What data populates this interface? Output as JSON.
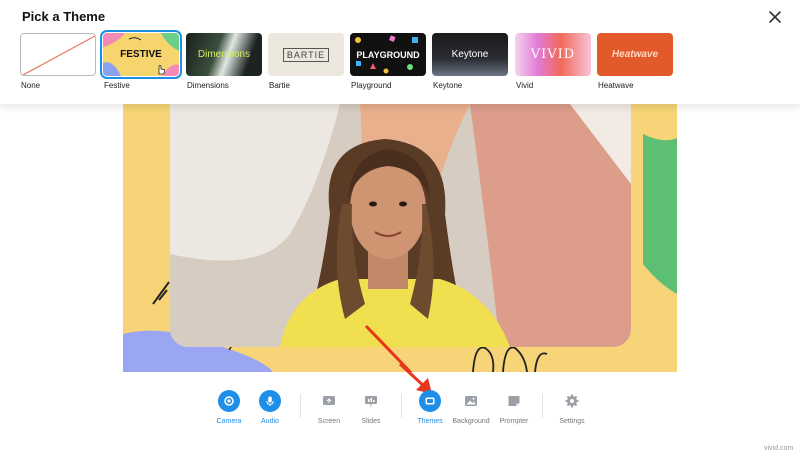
{
  "panel": {
    "title": "Pick a Theme"
  },
  "themes": [
    {
      "label": "None",
      "thumb_text": ""
    },
    {
      "label": "Festive",
      "thumb_text": "FESTIVE",
      "selected": true
    },
    {
      "label": "Dimensions",
      "thumb_text": "Dimensions"
    },
    {
      "label": "Bartie",
      "thumb_text": "BARTIE"
    },
    {
      "label": "Playground",
      "thumb_text": "PLAYGROUND"
    },
    {
      "label": "Keytone",
      "thumb_text": "Keytone"
    },
    {
      "label": "Vivid",
      "thumb_text": "VIVID"
    },
    {
      "label": "Heatwave",
      "thumb_text": "Heatwave"
    }
  ],
  "toolbar": {
    "camera": "Camera",
    "audio": "Audio",
    "screen": "Screen",
    "slides": "Slides",
    "themes": "Themes",
    "background": "Background",
    "prompter": "Prompter",
    "settings": "Settings"
  },
  "icons": {
    "close": "close-icon",
    "camera": "camera-icon",
    "audio": "microphone-icon",
    "screen": "screen-share-icon",
    "slides": "slides-icon",
    "themes": "themes-icon",
    "background": "image-icon",
    "prompter": "prompter-icon",
    "settings": "gear-icon"
  },
  "colors": {
    "accent": "#1f8ee8",
    "annotation_arrow": "#e8361c",
    "stage_yellow": "#f7d477"
  },
  "watermark": "vivid.com"
}
